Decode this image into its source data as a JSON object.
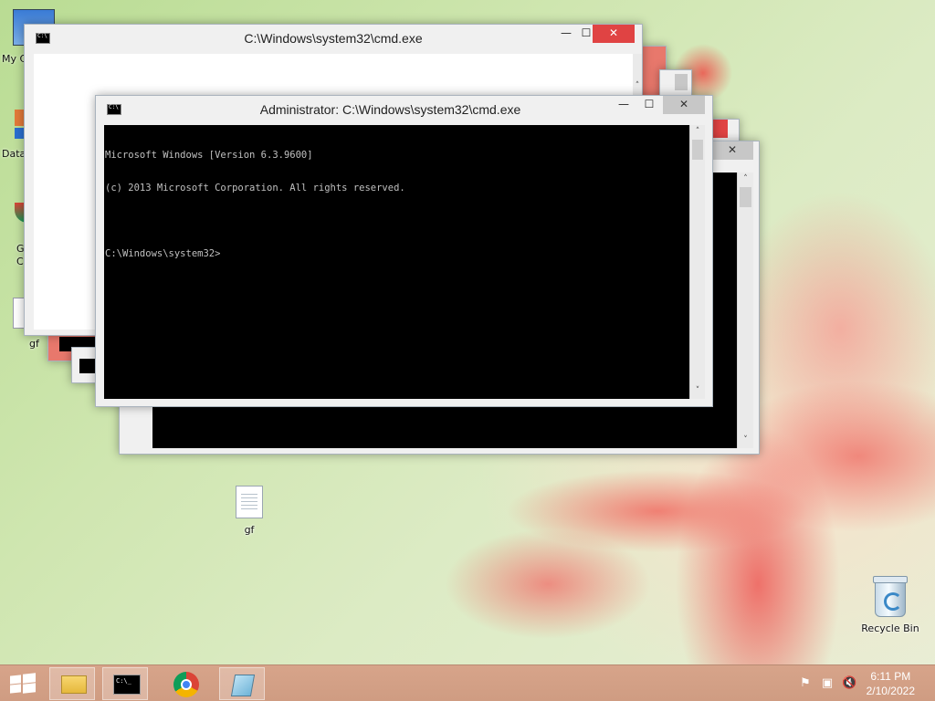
{
  "desktop": {
    "icons": [
      {
        "label": "gf"
      },
      {
        "label": "Recycle Bin"
      }
    ],
    "edge_labels": [
      "My C",
      "Data",
      "G",
      "C",
      "gf"
    ]
  },
  "windows": {
    "back": {
      "title": "C:\\Windows\\system32\\cmd.exe"
    },
    "front": {
      "title": "Administrator: C:\\Windows\\system32\\cmd.exe",
      "console_lines": [
        "Microsoft Windows [Version 6.3.9600]",
        "(c) 2013 Microsoft Corporation. All rights reserved.",
        "",
        "C:\\Windows\\system32>"
      ]
    },
    "controls": {
      "minimize": "—",
      "maximize": "☐",
      "close": "✕"
    },
    "scroll": {
      "up": "˄",
      "down": "˅"
    }
  },
  "taskbar": {
    "clock_time": "6:11 PM",
    "clock_date": "2/10/2022",
    "cmd_glyph": "C:\\_",
    "tray": {
      "flag": "⚑",
      "network": "▣",
      "volume": "🔇"
    }
  },
  "colors": {
    "close_active": "#e04343",
    "taskbar": "#d7a48a",
    "console_bg": "#000000",
    "console_text": "#c0c0c0"
  }
}
